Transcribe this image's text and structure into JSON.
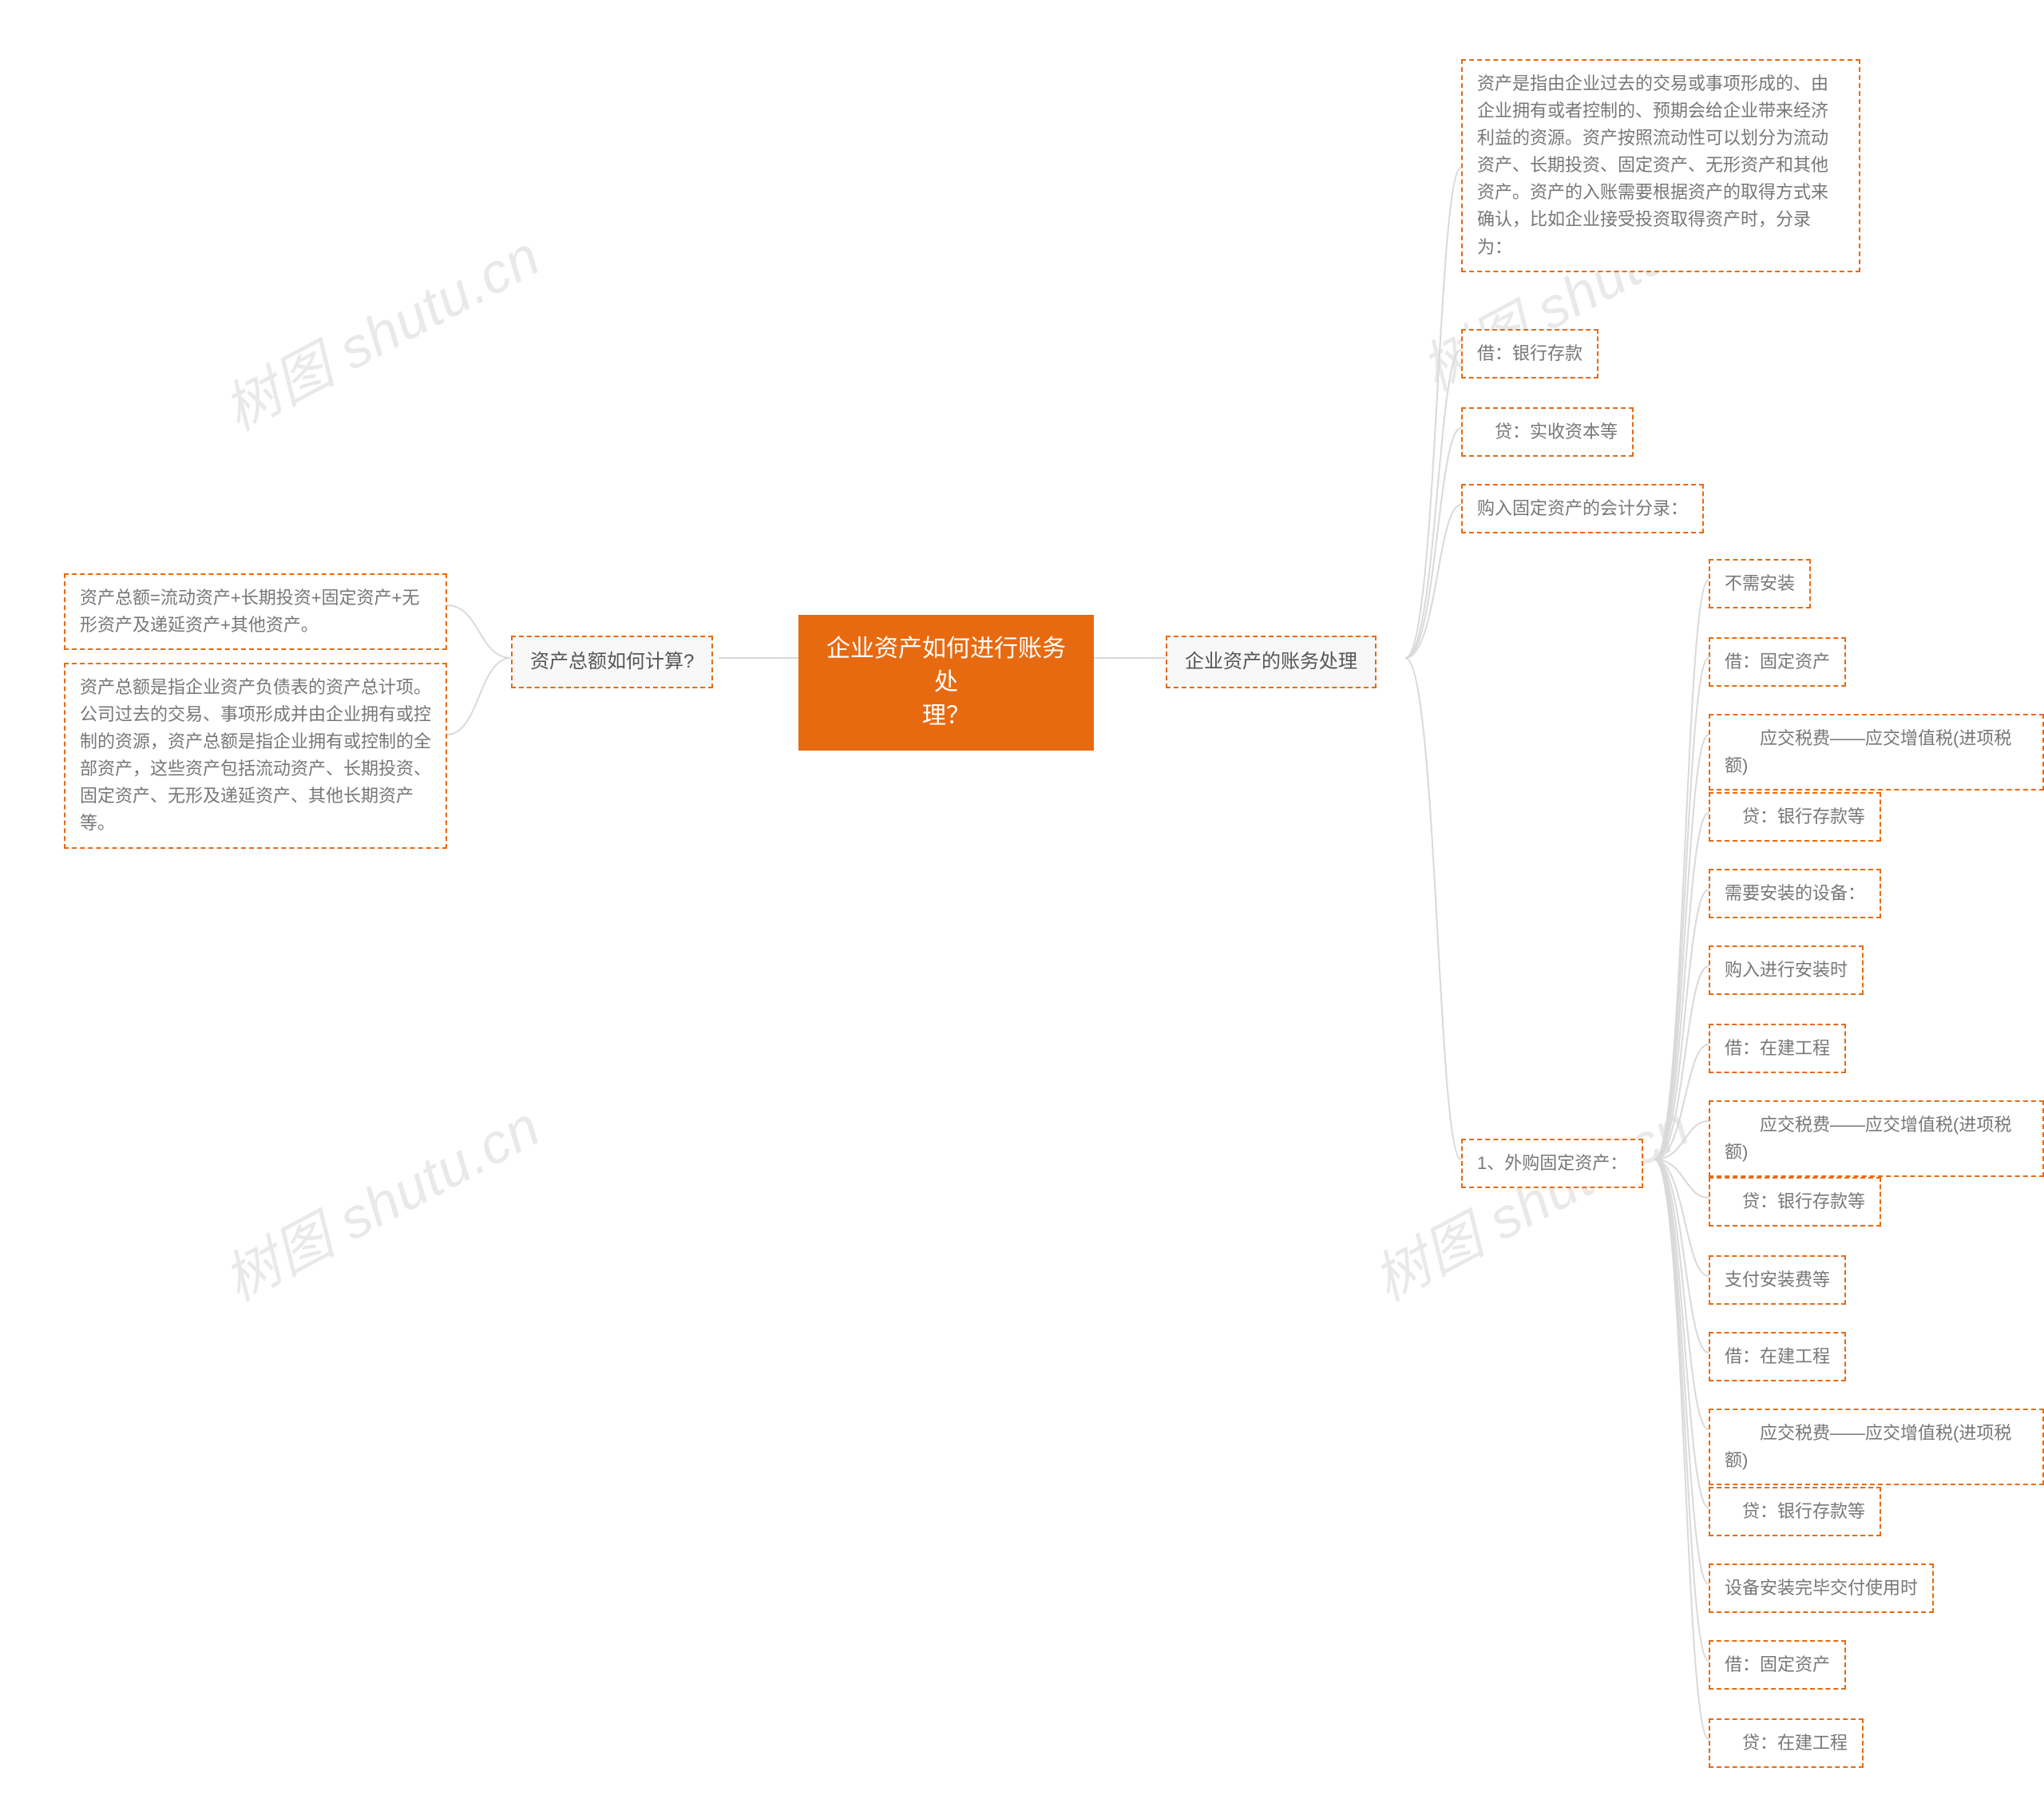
{
  "watermarks": {
    "w1": "树图 shutu.cn",
    "w2": "树图 shutu.cn",
    "w3": "树图 shutu.cn",
    "w4": "树图 shutu.cn"
  },
  "root": {
    "title_line1": "企业资产如何进行账务处",
    "title_line2": "理？"
  },
  "left": {
    "branch": "资产总额如何计算?",
    "leaf1": "资产总额=流动资产+长期投资+固定资产+无形资产及递延资产+其他资产。",
    "leaf2": "资产总额是指企业资产负债表的资产总计项。公司过去的交易、事项形成并由企业拥有或控制的资源，资产总额是指企业拥有或控制的全部资产，这些资产包括流动资产、长期投资、固定资产、无形及递延资产、其他长期资产等。"
  },
  "right": {
    "branch": "企业资产的账务处理",
    "r1": "资产是指由企业过去的交易或事项形成的、由企业拥有或者控制的、预期会给企业带来经济利益的资源。资产按照流动性可以划分为流动资产、长期投资、固定资产、无形资产和其他资产。资产的入账需要根据资产的取得方式来确认，比如企业接受投资取得资产时，分录为：",
    "r2": "借：银行存款",
    "r3": "　贷：实收资本等",
    "r4": "购入固定资产的会计分录：",
    "r5": "1、外购固定资产：",
    "sub": {
      "s1": "不需安装",
      "s2": "借：固定资产",
      "s3": "　　应交税费——应交增值税(进项税额)",
      "s4": "　贷：银行存款等",
      "s5": "需要安装的设备：",
      "s6": "购入进行安装时",
      "s7": "借：在建工程",
      "s8": "　　应交税费——应交增值税(进项税额)",
      "s9": "　贷：银行存款等",
      "s10": "支付安装费等",
      "s11": "借：在建工程",
      "s12": "　　应交税费——应交增值税(进项税额)",
      "s13": "　贷：银行存款等",
      "s14": "设备安装完毕交付使用时",
      "s15": "借：固定资产",
      "s16": "　贷：在建工程"
    }
  }
}
